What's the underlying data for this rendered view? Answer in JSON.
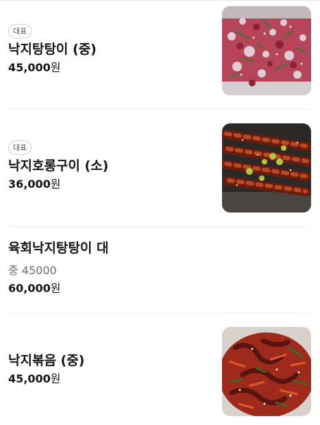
{
  "menu_items": [
    {
      "badge": "대표",
      "name": "낙지탕탕이 (중)",
      "price_number": "45,000",
      "price_unit": "원",
      "image": "raw-octopus-tangtangi-photo"
    },
    {
      "badge": "대표",
      "name": "낙지호롱구이 (소)",
      "price_number": "36,000",
      "price_unit": "원",
      "image": "grilled-octopus-skewers-photo"
    },
    {
      "name": "육회낙지탕탕이 대",
      "description": "중 45000",
      "price_number": "60,000",
      "price_unit": "원"
    },
    {
      "name": "낙지볶음 (중)",
      "price_number": "45,000",
      "price_unit": "원",
      "image": "stir-fried-octopus-photo"
    }
  ]
}
